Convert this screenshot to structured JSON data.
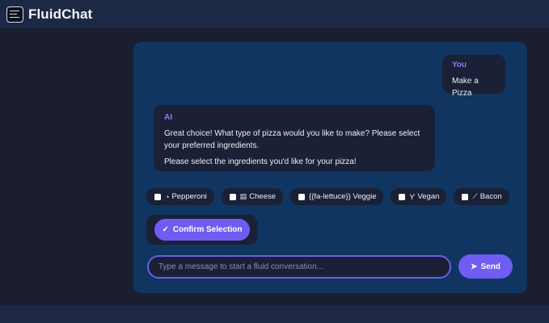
{
  "app": {
    "brand": "FluidChat",
    "logo_icon": "chat-screen-icon"
  },
  "chat": {
    "user_message": {
      "sender": "You",
      "text": "Make a Pizza"
    },
    "ai_message": {
      "sender": "AI",
      "lines": [
        "Great choice! What type of pizza would you like to make? Please select your preferred ingredients.",
        "Please select the ingredients you'd like for your pizza!"
      ]
    }
  },
  "options": [
    {
      "label": "Pepperoni",
      "icon": "pizza-slice-icon",
      "glyph": "◔",
      "checked": false
    },
    {
      "label": "Cheese",
      "icon": "cheese-icon",
      "glyph": "▤",
      "checked": false
    },
    {
      "label": "{{fa-lettuce}} Veggie",
      "icon": "",
      "glyph": "",
      "checked": false
    },
    {
      "label": "Vegan",
      "icon": "seedling-icon",
      "glyph": "ϒ",
      "checked": false
    },
    {
      "label": "Bacon",
      "icon": "bacon-icon",
      "glyph": "⟋",
      "checked": false
    }
  ],
  "confirm": {
    "label": "Confirm Selection",
    "icon": "check-icon",
    "glyph": "✓"
  },
  "composer": {
    "placeholder": "Type a message to start a fluid conversation...",
    "value": "",
    "send_label": "Send",
    "send_icon": "paper-plane-icon",
    "send_glyph": "➤"
  },
  "colors": {
    "background": "#1b1e31",
    "topbar": "#1d2844",
    "panel": "#0f3560",
    "bubble": "#1a2036",
    "accent": "#6f5cf2",
    "sender_label": "#8c7cf6"
  }
}
